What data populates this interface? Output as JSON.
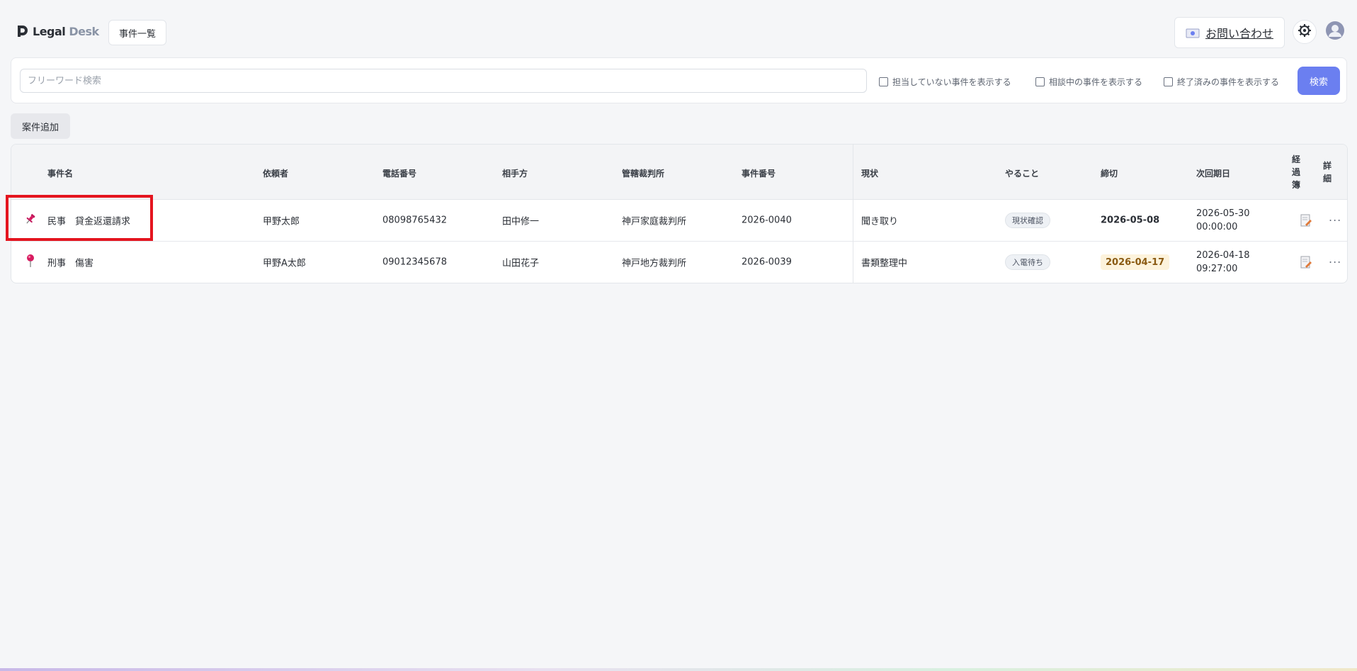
{
  "header": {
    "logo_primary": "Legal",
    "logo_secondary": "Desk",
    "nav_tab": "事件一覧",
    "contact_label": "お問い合わせ"
  },
  "search": {
    "placeholder": "フリーワード検索",
    "value": "",
    "checkboxes": [
      {
        "label": "担当していない事件を表示する",
        "checked": false
      },
      {
        "label": "相談中の事件を表示する",
        "checked": false
      },
      {
        "label": "終了済みの事件を表示する",
        "checked": false
      }
    ],
    "button": "検索"
  },
  "add_button": "案件追加",
  "table": {
    "headers": {
      "case_name": "事件名",
      "client": "依頼者",
      "phone": "電話番号",
      "opponent": "相手方",
      "court": "管轄裁判所",
      "case_no": "事件番号",
      "status": "現状",
      "todo": "やること",
      "deadline": "締切",
      "next_date": "次回期日",
      "progress_l1": "経",
      "progress_l2": "過",
      "progress_l3": "簿",
      "detail_l1": "詳",
      "detail_l2": "細"
    },
    "rows": [
      {
        "pin_icon": "pushpin-icon",
        "case_name": "民事　貸金返還請求",
        "client": "甲野太郎",
        "phone": "08098765432",
        "opponent": "田中修一",
        "court": "神戸家庭裁判所",
        "case_no": "2026-0040",
        "status": "聞き取り",
        "todo": "現状確認",
        "deadline": "2026-05-08",
        "next_date_l1": "2026-05-30",
        "next_date_l2": "00:00:00",
        "more": "···"
      },
      {
        "pin_icon": "round-pin-icon",
        "case_name": "刑事　傷害",
        "client": "甲野A太郎",
        "phone": "09012345678",
        "opponent": "山田花子",
        "court": "神戸地方裁判所",
        "case_no": "2026-0039",
        "status": "書類整理中",
        "todo": "入電待ち",
        "deadline": "2026-04-17",
        "next_date_l1": "2026-04-18",
        "next_date_l2": "09:27:00",
        "more": "···"
      }
    ]
  },
  "colors": {
    "accent": "#6b7ff0",
    "highlight": "#e4151f",
    "deadline_warn_bg": "#fdf3dc"
  }
}
